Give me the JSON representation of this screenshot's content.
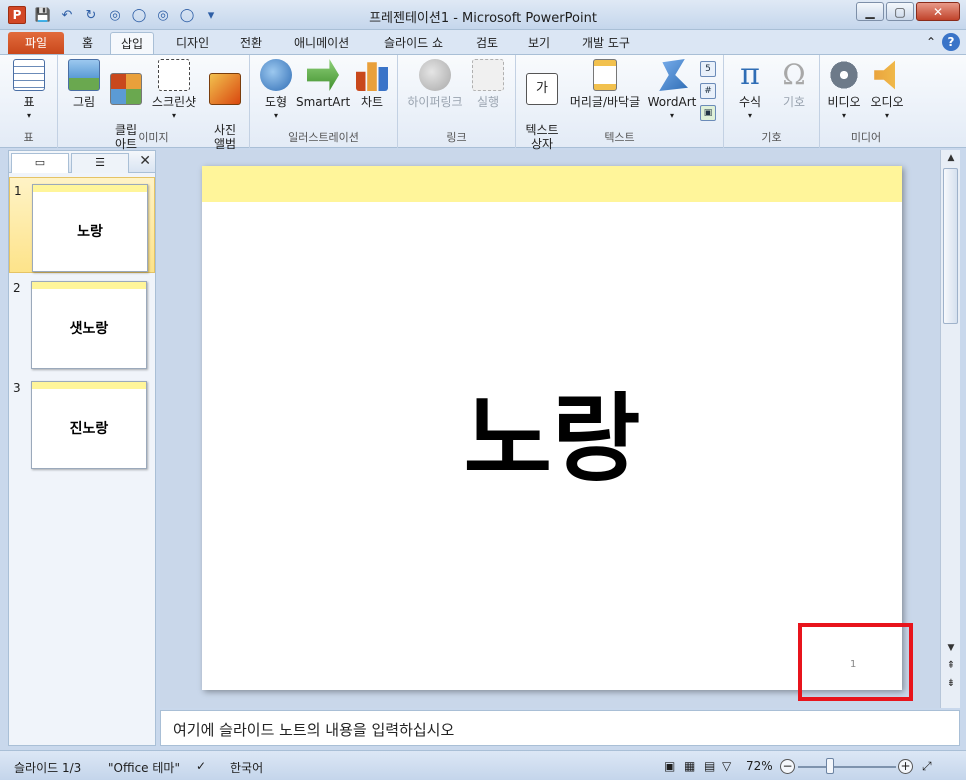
{
  "window": {
    "title": "프레젠테이션1 - Microsoft PowerPoint",
    "app_icon": "P"
  },
  "tabs": [
    {
      "label": "파일"
    },
    {
      "label": "홈"
    },
    {
      "label": "삽입"
    },
    {
      "label": "디자인"
    },
    {
      "label": "전환"
    },
    {
      "label": "애니메이션"
    },
    {
      "label": "슬라이드 쇼"
    },
    {
      "label": "검토"
    },
    {
      "label": "보기"
    },
    {
      "label": "개발 도구"
    }
  ],
  "ribbon": {
    "groups": [
      {
        "label": "표"
      },
      {
        "label": "이미지"
      },
      {
        "label": "일러스트레이션"
      },
      {
        "label": "링크"
      },
      {
        "label": "텍스트"
      },
      {
        "label": "기호"
      },
      {
        "label": "미디어"
      }
    ],
    "buttons": {
      "table": "표",
      "picture": "그림",
      "clipart": "클립\n아트",
      "screenshot": "스크린샷",
      "photo_album": "사진\n앨범",
      "shapes": "도형",
      "smartart": "SmartArt",
      "chart": "차트",
      "hyperlink": "하이퍼링크",
      "action": "실행",
      "textbox": "텍스트\n상자",
      "header_footer": "머리글/바닥글",
      "wordart": "WordArt",
      "equation": "수식",
      "symbol": "기호",
      "video": "비디오",
      "audio": "오디오"
    }
  },
  "slides": [
    {
      "num": "1",
      "title": "노랑"
    },
    {
      "num": "2",
      "title": "샛노랑"
    },
    {
      "num": "3",
      "title": "진노랑"
    }
  ],
  "current_slide": {
    "title": "노랑",
    "slide_number": "1"
  },
  "notes": {
    "placeholder": "여기에 슬라이드 노트의 내용을 입력하십시오"
  },
  "status": {
    "slide_info": "슬라이드 1/3",
    "theme": "\"Office 테마\"",
    "language": "한국어",
    "zoom": "72%"
  }
}
